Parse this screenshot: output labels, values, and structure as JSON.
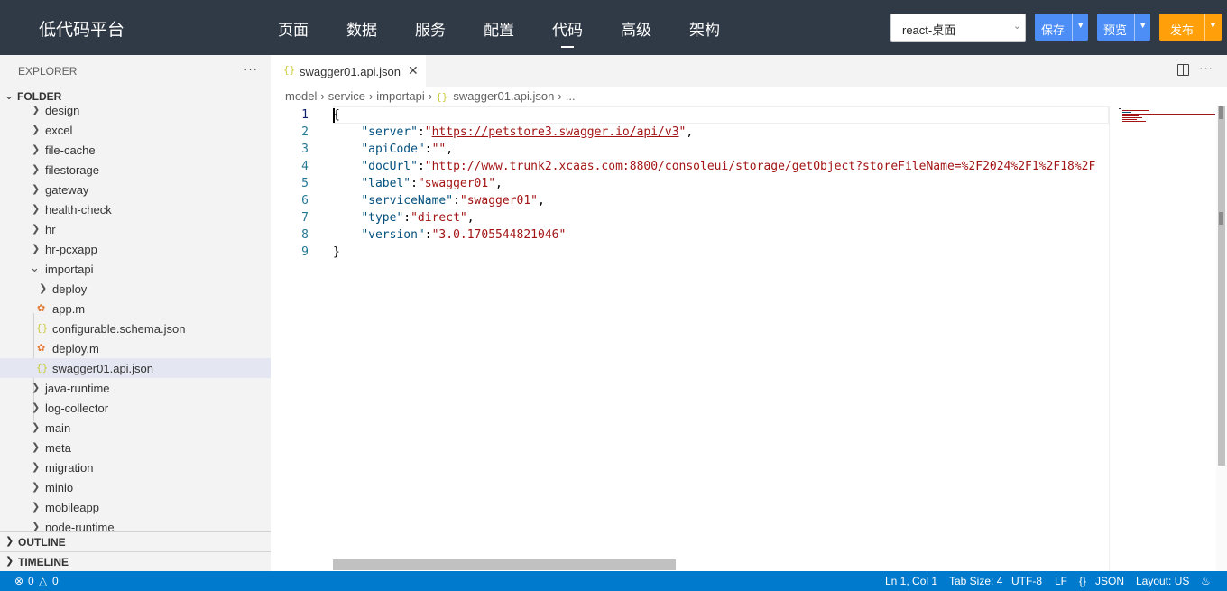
{
  "app": {
    "title": "低代码平台"
  },
  "nav": {
    "items": [
      "页面",
      "数据",
      "服务",
      "配置",
      "代码",
      "高级",
      "架构"
    ],
    "active": "代码"
  },
  "toolbar": {
    "platform_select": "react-桌面",
    "save_label": "保存",
    "preview_label": "预览",
    "publish_label": "发布"
  },
  "colors": {
    "topbar": "#2f3a46",
    "accent_blue": "#4c8ef5",
    "accent_orange": "#ffa00a",
    "statusbar": "#007acc"
  },
  "sidebar": {
    "explorer_label": "EXPLORER",
    "folder_label": "FOLDER",
    "tree": [
      {
        "name": "design",
        "type": "folder",
        "level": 1,
        "expanded": false
      },
      {
        "name": "excel",
        "type": "folder",
        "level": 1,
        "expanded": false
      },
      {
        "name": "file-cache",
        "type": "folder",
        "level": 1,
        "expanded": false
      },
      {
        "name": "filestorage",
        "type": "folder",
        "level": 1,
        "expanded": false
      },
      {
        "name": "gateway",
        "type": "folder",
        "level": 1,
        "expanded": false
      },
      {
        "name": "health-check",
        "type": "folder",
        "level": 1,
        "expanded": false
      },
      {
        "name": "hr",
        "type": "folder",
        "level": 1,
        "expanded": false
      },
      {
        "name": "hr-pcxapp",
        "type": "folder",
        "level": 1,
        "expanded": false
      },
      {
        "name": "importapi",
        "type": "folder",
        "level": 1,
        "expanded": true
      },
      {
        "name": "deploy",
        "type": "folder",
        "level": 2,
        "expanded": false
      },
      {
        "name": "app.m",
        "type": "file",
        "icon": "rss-icon",
        "level": 2
      },
      {
        "name": "configurable.schema.json",
        "type": "file",
        "icon": "json-icon",
        "level": 2
      },
      {
        "name": "deploy.m",
        "type": "file",
        "icon": "rss-icon",
        "level": 2
      },
      {
        "name": "swagger01.api.json",
        "type": "file",
        "icon": "json-icon",
        "level": 2,
        "selected": true
      },
      {
        "name": "java-runtime",
        "type": "folder",
        "level": 1,
        "expanded": false
      },
      {
        "name": "log-collector",
        "type": "folder",
        "level": 1,
        "expanded": false
      },
      {
        "name": "main",
        "type": "folder",
        "level": 1,
        "expanded": false
      },
      {
        "name": "meta",
        "type": "folder",
        "level": 1,
        "expanded": false
      },
      {
        "name": "migration",
        "type": "folder",
        "level": 1,
        "expanded": false
      },
      {
        "name": "minio",
        "type": "folder",
        "level": 1,
        "expanded": false
      },
      {
        "name": "mobileapp",
        "type": "folder",
        "level": 1,
        "expanded": false
      },
      {
        "name": "node-runtime",
        "type": "folder",
        "level": 1,
        "expanded": false
      }
    ],
    "outline_label": "OUTLINE",
    "timeline_label": "TIMELINE"
  },
  "editor": {
    "tab": {
      "icon": "{}",
      "label": "swagger01.api.json"
    },
    "breadcrumb": [
      "model",
      "service",
      "importapi",
      "swagger01.api.json",
      "..."
    ],
    "line_numbers": [
      "1",
      "2",
      "3",
      "4",
      "5",
      "6",
      "7",
      "8",
      "9"
    ],
    "code": {
      "l1": "{",
      "server_key": "\"server\"",
      "server_val": "https://petstore3.swagger.io/api/v3",
      "apiCode_key": "\"apiCode\"",
      "apiCode_val": "\"\"",
      "docUrl_key": "\"docUrl\"",
      "docUrl_val": "http://www.trunk2.xcaas.com:8800/consoleui/storage/getObject?storeFileName=%2F2024%2F1%2F18%2F",
      "label_key": "\"label\"",
      "label_val": "\"swagger01\"",
      "serviceName_key": "\"serviceName\"",
      "serviceName_val": "\"swagger01\"",
      "type_key": "\"type\"",
      "type_val": "\"direct\"",
      "version_key": "\"version\"",
      "version_val": "\"3.0.1705544821046\"",
      "l9": "}"
    }
  },
  "statusbar": {
    "errors": "0",
    "warnings": "0",
    "position": "Ln 1, Col 1",
    "tab_size": "Tab Size: 4",
    "encoding": "UTF-8",
    "eol": "LF",
    "language": "JSON",
    "layout": "Layout: US"
  }
}
